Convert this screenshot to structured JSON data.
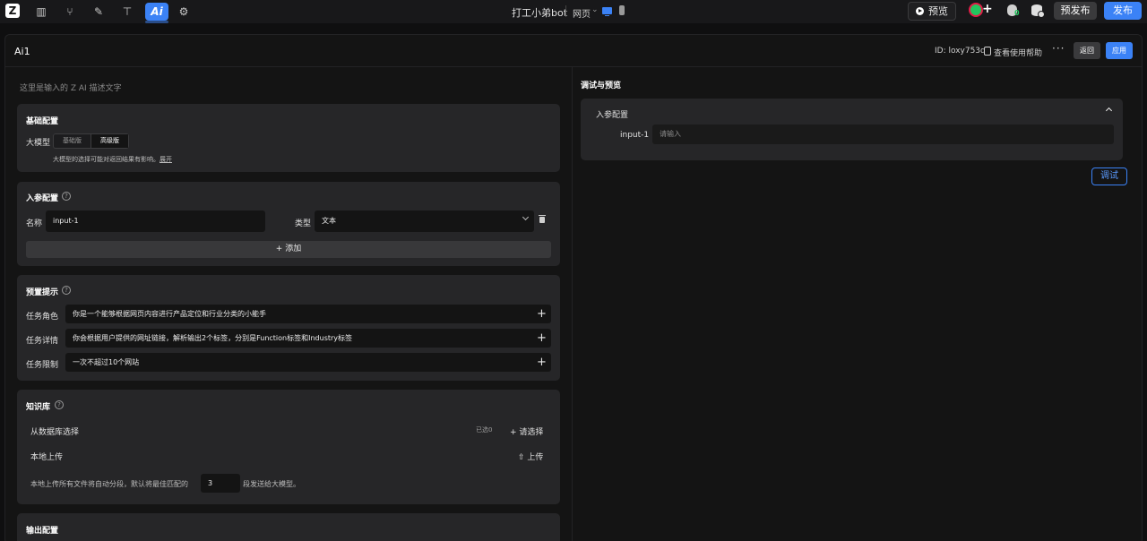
{
  "topbar": {
    "logo": "Z",
    "tools": [
      {
        "icon": "layout-icon",
        "glyph": "▥"
      },
      {
        "icon": "flow-icon",
        "glyph": "⑂"
      },
      {
        "icon": "plugin-icon",
        "glyph": "✎"
      },
      {
        "icon": "table-icon",
        "glyph": "⊤"
      },
      {
        "icon": "ai-icon",
        "glyph": "Ai"
      },
      {
        "icon": "settings-icon",
        "glyph": "⚙"
      }
    ],
    "app_name": "打工小弟bot",
    "page_type": "网页",
    "page_caret": "⌄",
    "preview_label": "预览",
    "avatar_plus": "+",
    "prepublish_label": "预发布",
    "publish_label": "发布",
    "accent": "#3b82f6"
  },
  "panel": {
    "title": "Ai1",
    "id_text": "ID: loxy753q",
    "help_label": "查看使用帮助",
    "more_glyph": "···",
    "back_label": "返回",
    "apply_label": "应用"
  },
  "description": "这里是输入的 Z AI 描述文字",
  "basic_config": {
    "title": "基础配置",
    "model_label": "大模型",
    "options": [
      "基础版",
      "高级版"
    ],
    "selected": "高级版",
    "hint": "大模型的选择可能对返回结果有影响。",
    "hint_link": "展开"
  },
  "input_params": {
    "title": "入参配置",
    "help_glyph": "?",
    "name_label": "名称",
    "name_value": "input-1",
    "type_label": "类型",
    "type_value": "文本",
    "add_label": "+ 添加"
  },
  "preset_prompt": {
    "title": "预置提示",
    "help_glyph": "?",
    "rows": [
      {
        "label": "任务角色",
        "value": "你是一个能够根据网页内容进行产品定位和行业分类的小能手"
      },
      {
        "label": "任务详情",
        "value": "你会根据用户提供的网址链接，解析输出2个标签，分别是Function标签和Industry标签"
      },
      {
        "label": "任务限制",
        "value": "一次不超过10个网站"
      }
    ],
    "plus_glyph": "+"
  },
  "knowledge": {
    "title": "知识库",
    "help_glyph": "?",
    "db_label": "从数据库选择",
    "selected_count": "已选0",
    "choose_label": "+ 请选择",
    "local_label": "本地上传",
    "upload_label": "⇧ 上传",
    "note_before": "本地上传所有文件将自动分段，默认将最佳匹配的",
    "segments": "3",
    "note_after": "段发送给大模型。"
  },
  "output_config": {
    "title": "输出配置"
  },
  "debug_preview": {
    "title": "调试与预览",
    "section_title": "入参配置",
    "input_label": "input-1",
    "input_placeholder": "请输入",
    "debug_label": "调试"
  }
}
